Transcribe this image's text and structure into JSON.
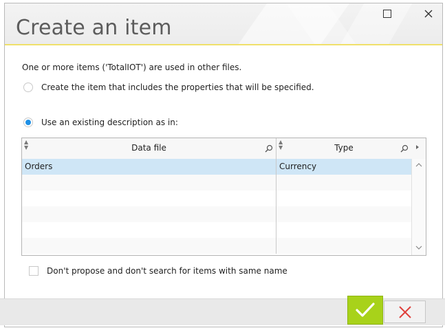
{
  "window": {
    "title": "Create an item",
    "maximize_icon": "maximize-icon",
    "close_icon": "close-icon"
  },
  "colors": {
    "accent_line": "#f0e06a",
    "radio_selected": "#1e90e6",
    "row_selected": "#cfe6f6",
    "ok_button": "#a8d21a",
    "cancel_x": "#e0413d"
  },
  "message": "One or more items ('TotalIOT') are used in other files.",
  "options": {
    "create": {
      "label": "Create the item that includes the properties that will be specified.",
      "selected": false
    },
    "use_existing": {
      "label": "Use an existing description as in:",
      "selected": true
    }
  },
  "table": {
    "columns": [
      {
        "label": "Data file"
      },
      {
        "label": "Type"
      }
    ],
    "rows": [
      {
        "data_file": "Orders",
        "type": "Currency",
        "selected": true
      }
    ]
  },
  "no_propose": {
    "label": "Don't propose and don't search for items with same name",
    "checked": false
  },
  "buttons": {
    "ok_icon": "checkmark-icon",
    "cancel_icon": "cancel-x-icon"
  }
}
